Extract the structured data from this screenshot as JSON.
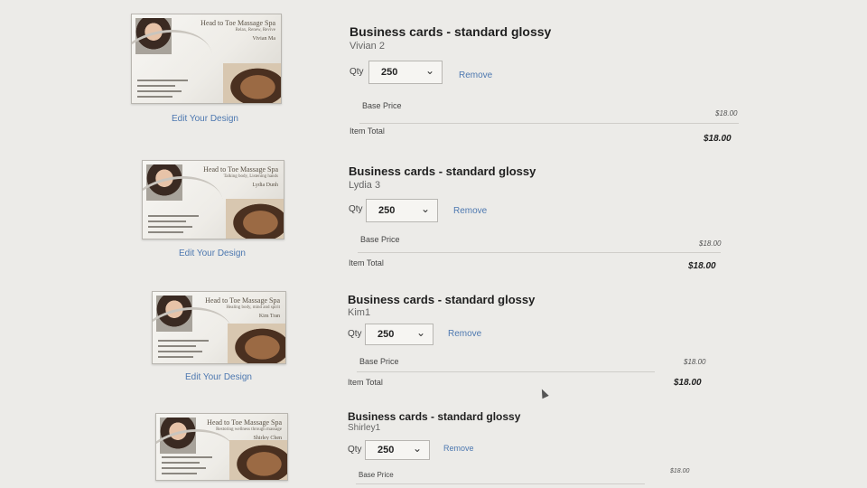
{
  "items": [
    {
      "title": "Business cards - standard glossy",
      "name": "Vivian 2",
      "qty_label": "Qty",
      "qty": "250",
      "remove": "Remove",
      "edit": "Edit Your Design",
      "base_label": "Base Price",
      "base_price": "$18.00",
      "total_label": "Item Total",
      "total": "$18.00",
      "card": {
        "company": "Head to Toe Massage Spa",
        "tagline": "Relax, Renew, Revive",
        "person": "Vivian Ma"
      }
    },
    {
      "title": "Business cards - standard glossy",
      "name": "Lydia 3",
      "qty_label": "Qty",
      "qty": "250",
      "remove": "Remove",
      "edit": "Edit Your Design",
      "base_label": "Base Price",
      "base_price": "$18.00",
      "total_label": "Item Total",
      "total": "$18.00",
      "card": {
        "company": "Head to Toe Massage Spa",
        "tagline": "Talking body, Listening hands",
        "person": "Lydia Dunh"
      }
    },
    {
      "title": "Business cards - standard glossy",
      "name": "Kim1",
      "qty_label": "Qty",
      "qty": "250",
      "remove": "Remove",
      "edit": "Edit Your Design",
      "base_label": "Base Price",
      "base_price": "$18.00",
      "total_label": "Item Total",
      "total": "$18.00",
      "card": {
        "company": "Head to Toe Massage Spa",
        "tagline": "Healing body, mind and spirit",
        "person": "Kim Tran"
      }
    },
    {
      "title": "Business cards - standard glossy",
      "name": "Shirley1",
      "qty_label": "Qty",
      "qty": "250",
      "remove": "Remove",
      "base_label": "Base Price",
      "base_price": "$18.00",
      "card": {
        "company": "Head to Toe Massage Spa",
        "tagline": "Restoring wellness through massage",
        "person": "Shirley Chen"
      }
    }
  ],
  "icons": {
    "qty_dropdown": "chevron-down-icon",
    "cursor": "mouse-pointer-icon"
  },
  "colors": {
    "link": "#4d78b0",
    "background": "#ecebe8"
  }
}
